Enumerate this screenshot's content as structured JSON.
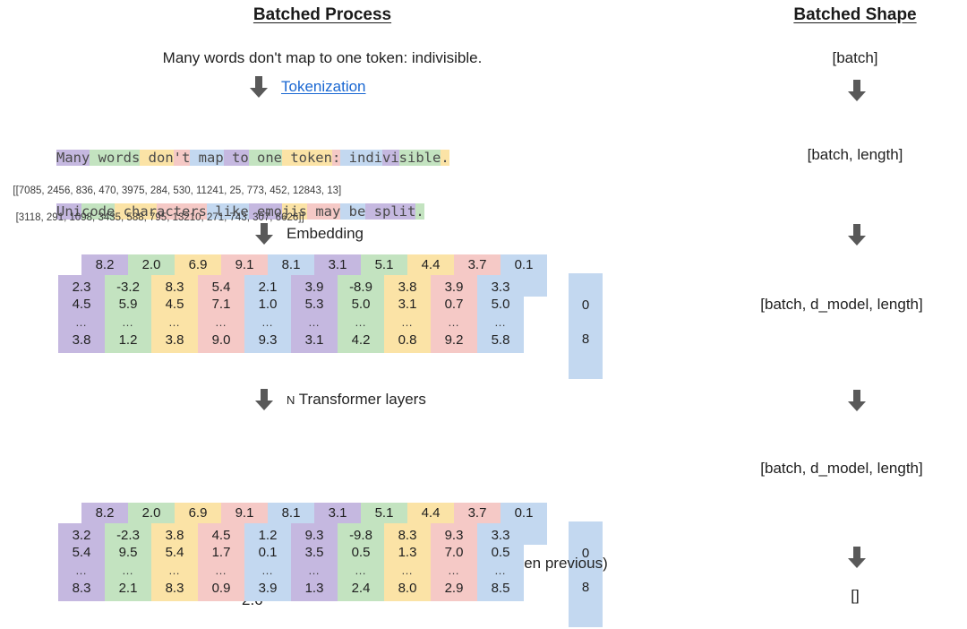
{
  "headings": {
    "left": "Batched Process",
    "right": "Batched Shape"
  },
  "palette": {
    "purple": "#c5b8e0",
    "green": "#c3e3c0",
    "yellow": "#fbe3a6",
    "pink": "#f5c9c6",
    "blue": "#c3d8f0",
    "arrow": "#595959",
    "link": "#1967d2"
  },
  "source_sentence": "Many words don't map to one token: indivisible.",
  "steps": {
    "tokenization": "Tokenization",
    "embedding": "Embedding",
    "transformer_n": "N",
    "transformer_rest": " Transformer layers",
    "loss": "Loss function (predict next token given previous)"
  },
  "tokenized": {
    "line1": [
      {
        "t": "Many",
        "c": "purple"
      },
      {
        "t": " words",
        "c": "green"
      },
      {
        "t": " don",
        "c": "yellow"
      },
      {
        "t": "'t",
        "c": "pink"
      },
      {
        "t": " map",
        "c": "blue"
      },
      {
        "t": " to",
        "c": "purple"
      },
      {
        "t": " one",
        "c": "green"
      },
      {
        "t": " token",
        "c": "yellow"
      },
      {
        "t": ":",
        "c": "pink"
      },
      {
        "t": " indi",
        "c": "blue"
      },
      {
        "t": "vi",
        "c": "purple"
      },
      {
        "t": "sible",
        "c": "green"
      },
      {
        "t": ".",
        "c": "yellow"
      }
    ],
    "line2": [
      {
        "t": "Uni",
        "c": "purple"
      },
      {
        "t": "code",
        "c": "green"
      },
      {
        "t": " char",
        "c": "yellow"
      },
      {
        "t": "acters",
        "c": "pink"
      },
      {
        "t": " like",
        "c": "blue"
      },
      {
        "t": " emo",
        "c": "purple"
      },
      {
        "t": "jis",
        "c": "yellow"
      },
      {
        "t": " may",
        "c": "pink"
      },
      {
        "t": " be",
        "c": "blue"
      },
      {
        "t": " split",
        "c": "purple"
      },
      {
        "t": ".",
        "c": "green"
      }
    ]
  },
  "token_ids": {
    "line1": "[[7085, 2456, 836, 470, 3975, 284, 530, 11241, 25, 773, 452, 12843, 13]",
    "line2": " [3118, 291, 1098, 3435, 588, 795, 13210, 271, 743, 307, 6626]]"
  },
  "matrix_embedding": {
    "colors": [
      "purple",
      "green",
      "yellow",
      "pink",
      "blue",
      "purple",
      "green",
      "yellow",
      "pink",
      "blue"
    ],
    "back_row": [
      "8.2",
      "2.0",
      "6.9",
      "9.1",
      "8.1",
      "3.1",
      "5.1",
      "4.4",
      "3.7",
      "0.1"
    ],
    "columns": [
      [
        "2.3",
        "4.5",
        "…",
        "3.8"
      ],
      [
        "-3.2",
        "5.9",
        "…",
        "1.2"
      ],
      [
        "8.3",
        "4.5",
        "…",
        "3.8"
      ],
      [
        "5.4",
        "7.1",
        "…",
        "9.0"
      ],
      [
        "2.1",
        "1.0",
        "…",
        "9.3"
      ],
      [
        "3.9",
        "5.3",
        "…",
        "3.1"
      ],
      [
        "-8.9",
        "5.0",
        "…",
        "4.2"
      ],
      [
        "3.8",
        "3.1",
        "…",
        "0.8"
      ],
      [
        "3.9",
        "0.7",
        "…",
        "9.2"
      ],
      [
        "3.3",
        "5.0",
        "…",
        "5.8"
      ]
    ],
    "side_digits": [
      "0",
      "",
      "8",
      ""
    ]
  },
  "matrix_transformer": {
    "colors": [
      "purple",
      "green",
      "yellow",
      "pink",
      "blue",
      "purple",
      "green",
      "yellow",
      "pink",
      "blue"
    ],
    "back_row": [
      "8.2",
      "2.0",
      "6.9",
      "9.1",
      "8.1",
      "3.1",
      "5.1",
      "4.4",
      "3.7",
      "0.1"
    ],
    "columns": [
      [
        "3.2",
        "5.4",
        "…",
        "8.3"
      ],
      [
        "-2.3",
        "9.5",
        "…",
        "2.1"
      ],
      [
        "3.8",
        "5.4",
        "…",
        "8.3"
      ],
      [
        "4.5",
        "1.7",
        "…",
        "0.9"
      ],
      [
        "1.2",
        "0.1",
        "…",
        "3.9"
      ],
      [
        "9.3",
        "3.5",
        "…",
        "1.3"
      ],
      [
        "-9.8",
        "0.5",
        "…",
        "2.4"
      ],
      [
        "8.3",
        "1.3",
        "…",
        "8.0"
      ],
      [
        "9.3",
        "7.0",
        "…",
        "2.9"
      ],
      [
        "3.3",
        "0.5",
        "…",
        "8.5"
      ]
    ],
    "side_digits": [
      "0",
      "",
      "8",
      ""
    ]
  },
  "loss_value": "2.6",
  "shapes": {
    "s1": "[batch]",
    "s2": "[batch, length]",
    "s3": "[batch, d_model, length]",
    "s4": "[batch, d_model, length]",
    "s5": "[]"
  }
}
